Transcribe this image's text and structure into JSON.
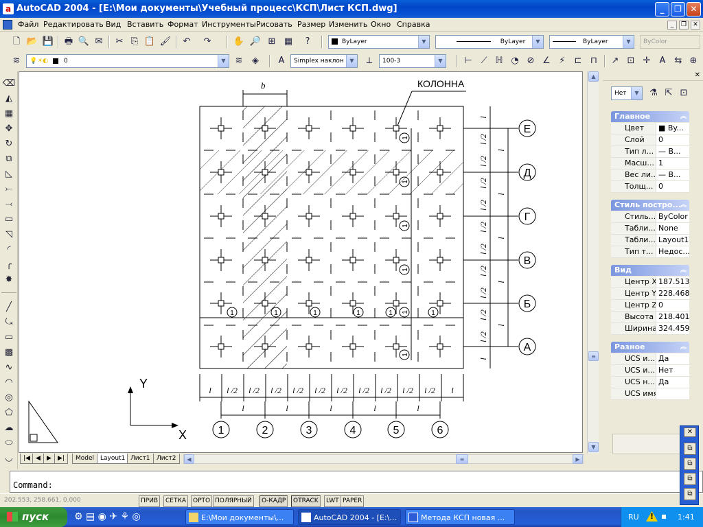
{
  "window": {
    "title": "AutoCAD 2004 - [E:\\Мои документы\\Учебный процесс\\КСП\\Лист КСП.dwg]",
    "app_icon": "autocad-a-icon"
  },
  "menu": [
    "Файл",
    "Редактировать",
    "Вид",
    "Вставить",
    "Формат",
    "Инструменты",
    "Рисовать",
    "Размер",
    "Изменить",
    "Окно",
    "Справка"
  ],
  "layer_toolbar": {
    "layer_name": "0"
  },
  "properties_toolbar": {
    "color": "ByLayer",
    "linetype": "ByLayer",
    "lineweight": "ByLayer",
    "plotstyle": "ByColor"
  },
  "style_toolbar": {
    "text_style": "Simplex наклон 3",
    "dim_style": "100-3"
  },
  "drawing": {
    "column_label": "КОЛОННА",
    "b_label": "b",
    "row_axes": [
      "Е",
      "Д",
      "Г",
      "В",
      "Б",
      "А"
    ],
    "col_axes": [
      "1",
      "2",
      "3",
      "4",
      "5",
      "6"
    ],
    "marker_one": "1",
    "span_l": "l",
    "span_half": "l /2",
    "ucs_x": "X",
    "ucs_y": "Y"
  },
  "layout_tabs": [
    "Model",
    "Layout1",
    "Лист1",
    "Лист2"
  ],
  "active_tab": "Layout1",
  "command": {
    "prompt": "Command:"
  },
  "status": {
    "coords": "202.553, 258.661, 0.000",
    "toggles": [
      "ПРИВ",
      "СЕТКА",
      "ОРТО",
      "ПОЛЯРНЫЙ",
      "О-КАДР",
      "OTRACK",
      "LWT",
      "PAPER"
    ]
  },
  "properties": {
    "selection": "Нет",
    "sections": [
      {
        "title": "Главное",
        "rows": [
          [
            "Цвет",
            "■ By..."
          ],
          [
            "Слой",
            "0"
          ],
          [
            "Тип л...",
            "— B..."
          ],
          [
            "Масш...",
            "1"
          ],
          [
            "Вес ли...",
            "— B..."
          ],
          [
            "Толщ...",
            "0"
          ]
        ]
      },
      {
        "title": "Стиль постро...",
        "rows": [
          [
            "Стиль...",
            "ByColor"
          ],
          [
            "Табли...",
            "None"
          ],
          [
            "Табли...",
            "Layout1"
          ],
          [
            "Тип т...",
            "Недос..."
          ]
        ]
      },
      {
        "title": "Вид",
        "rows": [
          [
            "Центр X",
            "187.513"
          ],
          [
            "Центр Y",
            "228.468"
          ],
          [
            "Центр Z",
            "0"
          ],
          [
            "Высота",
            "218.401"
          ],
          [
            "Ширина",
            "324.459"
          ]
        ]
      },
      {
        "title": "Разное",
        "rows": [
          [
            "UCS и...",
            "Да"
          ],
          [
            "UCS и...",
            "Нет"
          ],
          [
            "UCS н...",
            "Да"
          ],
          [
            "UCS имя",
            ""
          ]
        ]
      }
    ]
  },
  "taskbar": {
    "start": "пуск",
    "tasks": [
      "E:\\Мои документы\\...",
      "AutoCAD 2004 - [E:\\...",
      "Метода КСП новая ..."
    ],
    "lang": "RU",
    "clock": "1:41"
  }
}
